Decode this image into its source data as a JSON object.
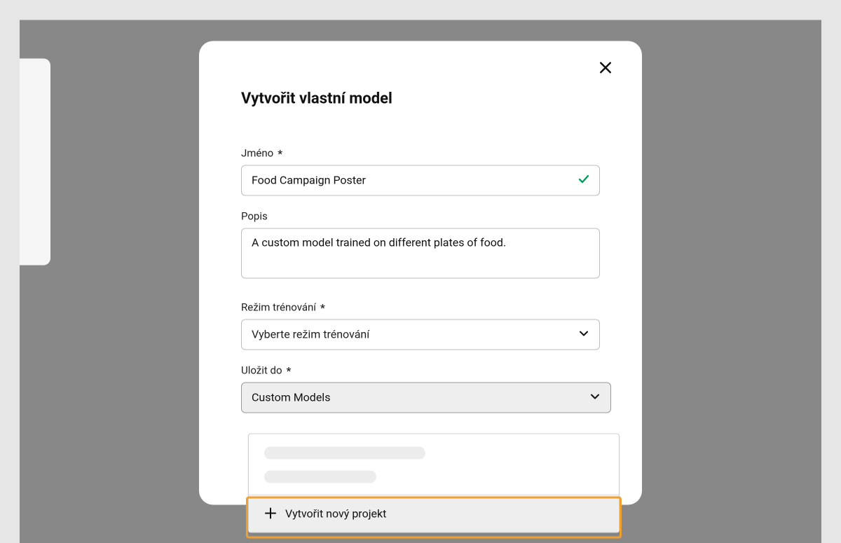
{
  "modal": {
    "title": "Vytvořit vlastní model"
  },
  "fields": {
    "name": {
      "label": "Jméno",
      "value": "Food Campaign Poster"
    },
    "description": {
      "label": "Popis",
      "value": "A custom model trained on different plates of food."
    },
    "training_mode": {
      "label": "Režim trénování",
      "placeholder": "Vyberte režim trénování"
    },
    "save_to": {
      "label": "Uložit do",
      "value": "Custom Models"
    }
  },
  "dropdown": {
    "new_project": "Vytvořit nový projekt"
  },
  "required_mark": "*"
}
